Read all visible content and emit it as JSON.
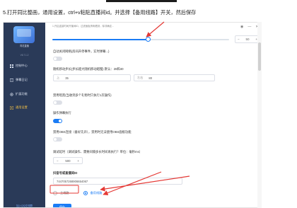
{
  "instruction": "5.打开同比整画，通用设置，ctrl+v粘贴直播间id。并选择【备用线路】开关，然后保存",
  "sidebar": {
    "logo_caption": "同花直播",
    "version": "V6.7.1.2",
    "items": [
      {
        "label": "控制中心",
        "icon": "grid-icon",
        "active": false
      },
      {
        "label": "弹幕日记",
        "icon": "chat-icon",
        "active": false
      },
      {
        "label": "扩展功能",
        "icon": "gear-icon",
        "active": false
      },
      {
        "label": "通用设置",
        "icon": "settings-icon",
        "active": true
      }
    ],
    "bottom_link": "加入QQ交流群"
  },
  "main": {
    "hint": "1.开启连接时间开播间ID，过滤面板清晰看到，除非确定...",
    "slider": {
      "value_fraction": 0.54,
      "stepper_value": "50"
    },
    "settings": [
      {
        "label": "自动关闭网络(房间开停事件，实时弹幕...)",
        "type": "toggle",
        "on": false
      },
      {
        "label": "随机移动步长(步长越大随机移动越慢) 默认：28和40",
        "type": "range"
      },
      {
        "label": "禁用暗黑(当收到多个礼物时只执行1次操作)",
        "type": "toggle",
        "on": false
      },
      {
        "label": "操作弹幕执行",
        "type": "toggle",
        "on": true
      },
      {
        "label": "禁用OBS连接（备好先开），禁用时无法使用OBS面板功能",
        "type": "toggle",
        "on": false
      },
      {
        "label": "调试延时（调试操作、需要间隔多长时间再执行？单位：毫秒ms）",
        "type": "stepper"
      },
      {
        "label": "抖音号或直播间ID",
        "type": "input"
      }
    ],
    "range": {
      "left_prefix": "上",
      "left_value": "35",
      "right_prefix": "左右",
      "right_value": "80"
    },
    "delay_value": "500",
    "room_id": "7447057268906654067",
    "radios": [
      {
        "label": "主线路",
        "checked": false
      },
      {
        "label": "备用线路",
        "checked": true
      }
    ],
    "save_label": "保存"
  },
  "colors": {
    "sidebar_bg": "#2a3a58",
    "accent": "#1a7cf5",
    "active_menu": "#f3c146",
    "annotation_red": "#e53935"
  }
}
